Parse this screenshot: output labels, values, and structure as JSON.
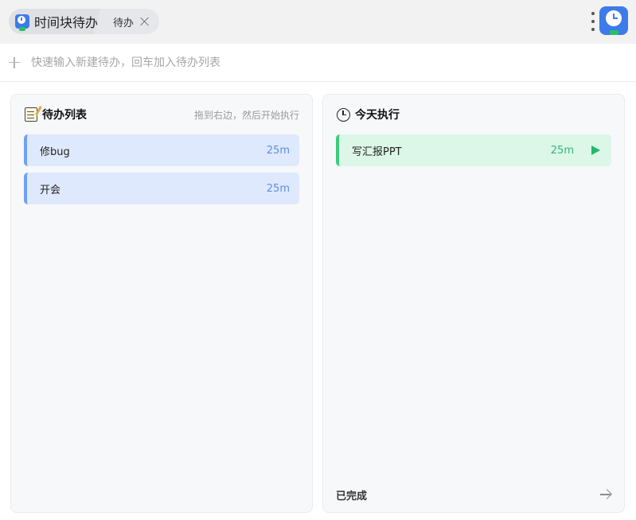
{
  "app": {
    "title": "时间块待办",
    "tab_label": "待办"
  },
  "quick_input": {
    "placeholder": "快速输入新建待办，回车加入待办列表"
  },
  "todo_panel": {
    "title": "待办列表",
    "hint": "拖到右边，然后开始执行",
    "items": [
      {
        "name": "修bug",
        "duration": "25m"
      },
      {
        "name": "开会",
        "duration": "25m"
      }
    ]
  },
  "today_panel": {
    "title": "今天执行",
    "items": [
      {
        "name": "写汇报PPT",
        "duration": "25m"
      }
    ],
    "done_label": "已完成"
  },
  "colors": {
    "accent_blue": "#3d7be8",
    "todo_bg": "#dfe9fd",
    "doing_bg": "#dcf6e7",
    "doing_green": "#22b867"
  },
  "icons": {
    "app": "clock-check-icon",
    "todo_panel": "memo-icon",
    "today_panel": "clock-icon",
    "start": "play-icon",
    "done": "arrow-right-icon",
    "add": "plus-icon",
    "more": "more-vertical-icon",
    "close": "close-icon"
  }
}
